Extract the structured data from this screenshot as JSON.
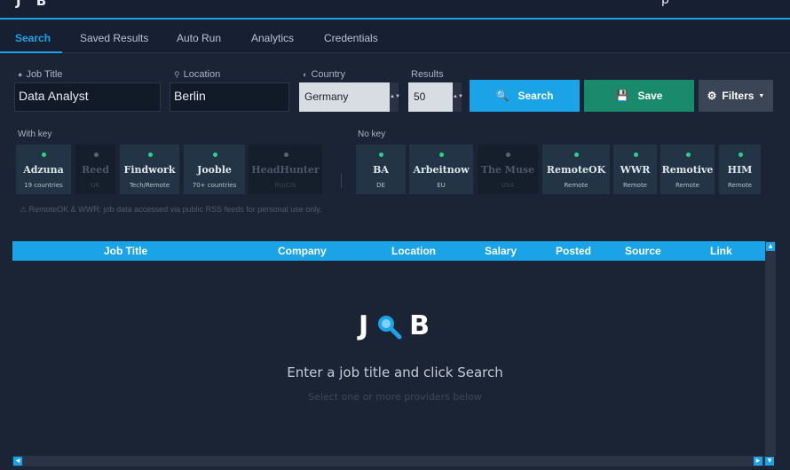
{
  "app": {
    "logo_text": "J B",
    "top_right_glyph": "p"
  },
  "tabs": [
    {
      "label": "Search",
      "active": true
    },
    {
      "label": "Saved Results",
      "active": false
    },
    {
      "label": "Auto Run",
      "active": false
    },
    {
      "label": "Analytics",
      "active": false
    },
    {
      "label": "Credentials",
      "active": false
    }
  ],
  "form": {
    "job_title": {
      "label": "Job Title",
      "value": "Data Analyst",
      "icon": "search-icon"
    },
    "location": {
      "label": "Location",
      "value": "Berlin",
      "icon": "pin-icon"
    },
    "country": {
      "label": "Country",
      "value": "Germany",
      "icon": "globe-icon"
    },
    "results": {
      "label": "Results",
      "value": "50"
    },
    "search_button": "Search",
    "save_button": "Save",
    "filters_button": "Filters"
  },
  "providers": {
    "with_key_label": "With key",
    "no_key_label": "No key",
    "with_key": [
      {
        "name": "Adzuna",
        "sub": "19 countries",
        "enabled": true
      },
      {
        "name": "Reed",
        "sub": "UK",
        "enabled": false
      },
      {
        "name": "Findwork",
        "sub": "Tech/Remote",
        "enabled": true
      },
      {
        "name": "Jooble",
        "sub": "70+ countries",
        "enabled": true
      },
      {
        "name": "HeadHunter",
        "sub": "RU/CIS",
        "enabled": false
      }
    ],
    "no_key": [
      {
        "name": "BA",
        "sub": "DE",
        "enabled": true
      },
      {
        "name": "Arbeitnow",
        "sub": "EU",
        "enabled": true
      },
      {
        "name": "The Muse",
        "sub": "USA",
        "enabled": false
      },
      {
        "name": "RemoteOK",
        "sub": "Remote",
        "enabled": true
      },
      {
        "name": "WWR",
        "sub": "Remote",
        "enabled": true
      },
      {
        "name": "Remotive",
        "sub": "Remote",
        "enabled": true
      },
      {
        "name": "HIM",
        "sub": "Remote",
        "enabled": true
      }
    ],
    "notice": "RemoteOK & WWR: job data accessed via public RSS feeds for personal use only."
  },
  "table": {
    "columns": [
      "Job Title",
      "Company",
      "Location",
      "Salary",
      "Posted",
      "Source",
      "Link"
    ],
    "rows": []
  },
  "empty_state": {
    "logo_left": "J",
    "logo_right": "B",
    "title": "Enter a job title and click Search",
    "subtitle": "Select one or more providers below"
  },
  "colors": {
    "accent": "#1aa3e6",
    "save_green": "#1a8a6c",
    "filters_gray": "#3a4556",
    "status_on": "#27d48b"
  }
}
